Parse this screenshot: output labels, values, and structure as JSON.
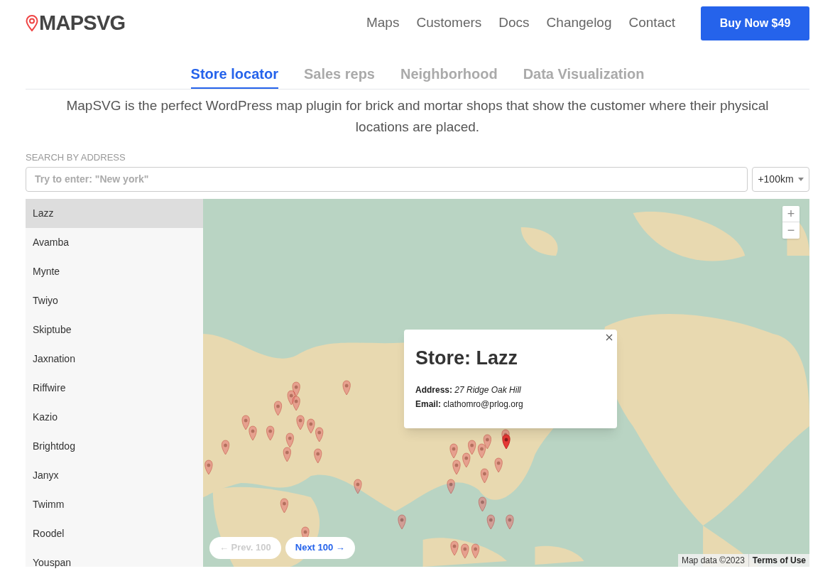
{
  "logo": {
    "text": "MAPSVG"
  },
  "nav": {
    "links": [
      "Maps",
      "Customers",
      "Docs",
      "Changelog",
      "Contact"
    ],
    "cta": "Buy Now $49"
  },
  "tabs": [
    {
      "label": "Store locator",
      "selected": true
    },
    {
      "label": "Sales reps",
      "selected": false
    },
    {
      "label": "Neighborhood",
      "selected": false
    },
    {
      "label": "Data Visualization",
      "selected": false
    }
  ],
  "description": "MapSVG is the perfect WordPress map plugin for brick and mortar shops that show the customer where their physical locations are placed.",
  "search": {
    "label": "SEARCH BY ADDRESS",
    "placeholder": "Try to enter: \"New york\"",
    "distance": "+100km"
  },
  "stores": [
    {
      "name": "Lazz",
      "selected": true
    },
    {
      "name": "Avamba",
      "selected": false
    },
    {
      "name": "Mynte",
      "selected": false
    },
    {
      "name": "Twiyo",
      "selected": false
    },
    {
      "name": "Skiptube",
      "selected": false
    },
    {
      "name": "Jaxnation",
      "selected": false
    },
    {
      "name": "Riffwire",
      "selected": false
    },
    {
      "name": "Kazio",
      "selected": false
    },
    {
      "name": "Brightdog",
      "selected": false
    },
    {
      "name": "Janyx",
      "selected": false
    },
    {
      "name": "Twimm",
      "selected": false
    },
    {
      "name": "Roodel",
      "selected": false
    },
    {
      "name": "Youspan",
      "selected": false
    }
  ],
  "popup": {
    "title": "Store: Lazz",
    "address_label": "Address:",
    "address": "27 Ridge Oak Hill",
    "email_label": "Email:",
    "email": "clathomro@prlog.org"
  },
  "map_controls": {
    "zoom_in": "+",
    "zoom_out": "−"
  },
  "pager": {
    "prev": {
      "label": "← Prev. 100",
      "disabled": true
    },
    "next": {
      "label": "Next 100 →",
      "disabled": false
    }
  },
  "attribution": {
    "data": "Map data ©2023",
    "terms": "Terms of Use"
  }
}
